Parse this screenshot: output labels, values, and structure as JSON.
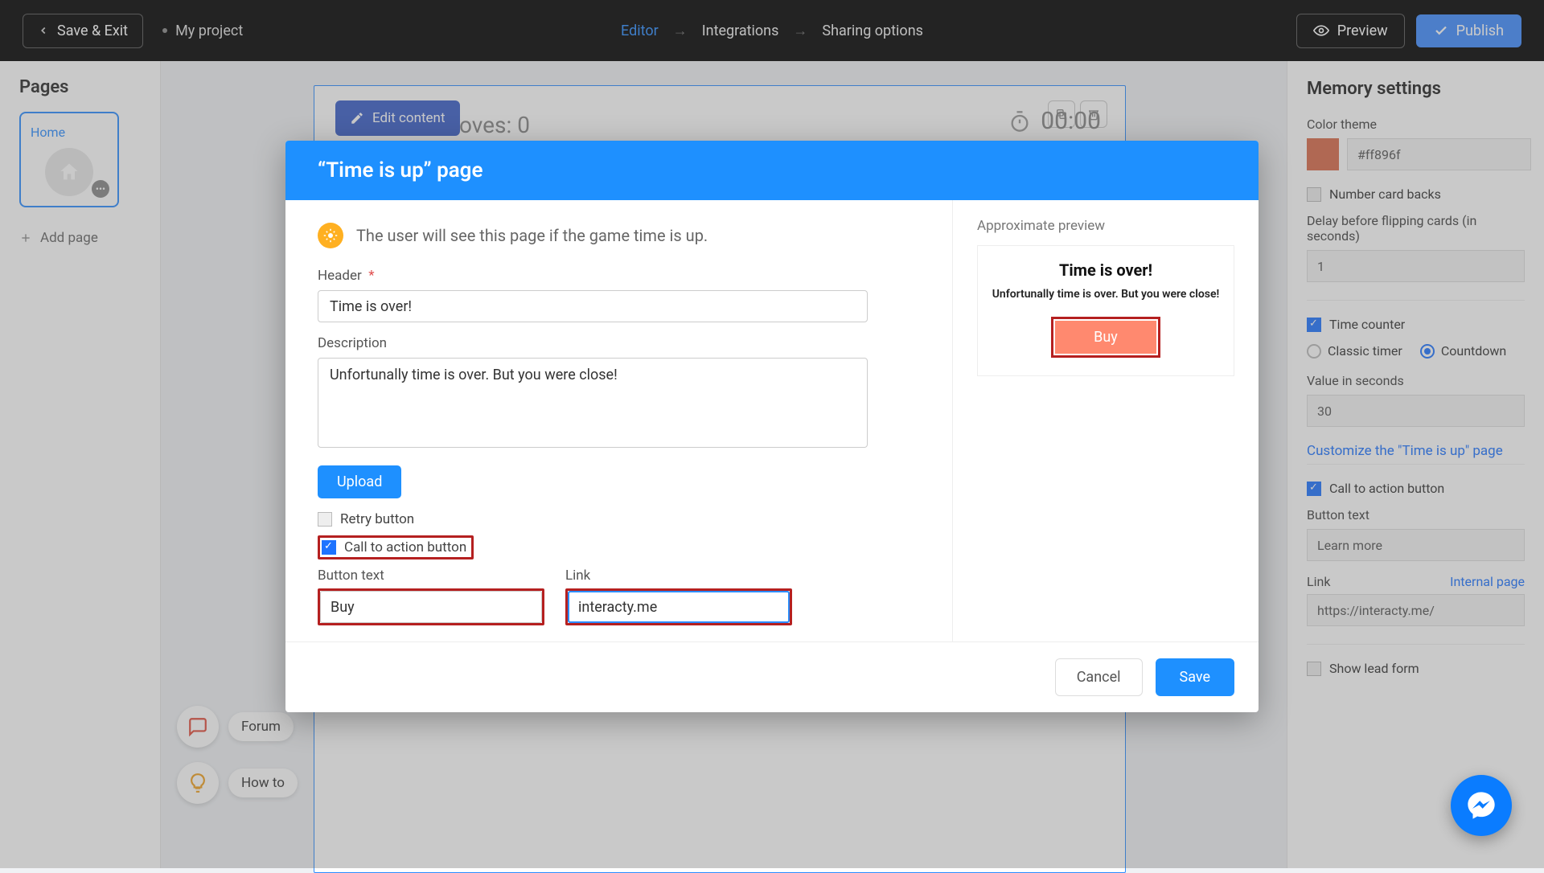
{
  "topbar": {
    "save_exit": "Save & Exit",
    "project": "My project",
    "steps": {
      "editor": "Editor",
      "integrations": "Integrations",
      "sharing": "Sharing options"
    },
    "preview": "Preview",
    "publish": "Publish"
  },
  "pages": {
    "title": "Pages",
    "home": "Home",
    "add": "Add page"
  },
  "canvas": {
    "edit_content": "Edit content",
    "moves_label": "oves:",
    "moves_value": "0",
    "timer": "00:00"
  },
  "float": {
    "forum": "Forum",
    "howto": "How to"
  },
  "settings": {
    "title": "Memory settings",
    "color_theme_label": "Color theme",
    "color_hex": "#ff896f",
    "number_backs": "Number card backs",
    "delay_label": "Delay before flipping cards (in seconds)",
    "delay_value": "1",
    "time_counter_label": "Time counter",
    "classic": "Classic timer",
    "countdown": "Countdown",
    "value_seconds_label": "Value in seconds",
    "value_seconds": "30",
    "customize_link": "Customize the \"Time is up\" page",
    "cta_label": "Call to action button",
    "button_text_label": "Button text",
    "button_text_value": "Learn more",
    "link_label": "Link",
    "internal_page": "Internal page",
    "link_value": "https://interacty.me/",
    "show_lead_form": "Show lead form"
  },
  "modal": {
    "title": "“Time is up” page",
    "info": "The user will see this page if the game time is up.",
    "header_label": "Header",
    "header_value": "Time is over!",
    "description_label": "Description",
    "description_value": "Unfortunally time is over. But you were close!",
    "upload": "Upload",
    "retry": "Retry button",
    "cta": "Call to action button",
    "button_text_label": "Button text",
    "button_text_value": "Buy",
    "link_label": "Link",
    "link_value": "interacty.me",
    "preview_label": "Approximate preview",
    "preview_title": "Time is over!",
    "preview_desc": "Unfortunally time is over. But you were close!",
    "preview_cta": "Buy",
    "cancel": "Cancel",
    "save": "Save"
  }
}
